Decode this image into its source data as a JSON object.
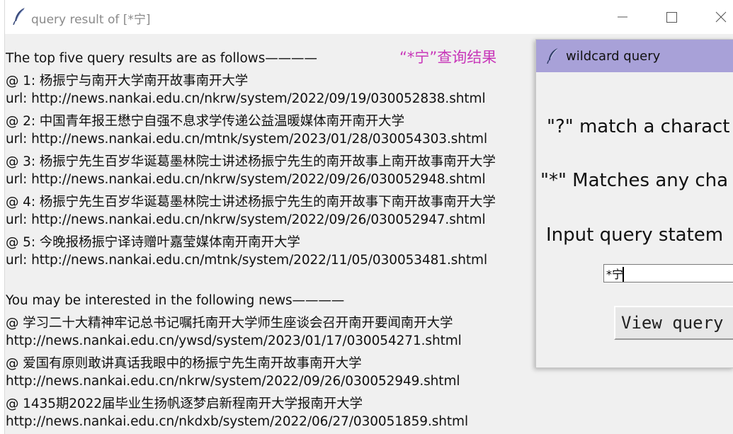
{
  "main_window": {
    "title": "query result of [*宁]",
    "feather_icon": "feather-icon",
    "controls": [
      "minimize-icon",
      "maximize-icon",
      "close-icon"
    ],
    "heading": "“*宁”查询结果",
    "heading_color": "#c837b9",
    "results_intro": "The top five query results are as follows————",
    "results": [
      {
        "title": " @ 1: 杨振宁与南开大学南开故事南开大学",
        "url": " url: http://news.nankai.edu.cn/nkrw/system/2022/09/19/030052838.shtml"
      },
      {
        "title": " @ 2: 中国青年报王懋宁自强不息求学传递公益温暖媒体南开南开大学",
        "url": " url: http://news.nankai.edu.cn/mtnk/system/2023/01/28/030054303.shtml"
      },
      {
        "title": " @ 3: 杨振宁先生百岁华诞葛墨林院士讲述杨振宁先生的南开故事上南开故事南开大学",
        "url": " url: http://news.nankai.edu.cn/nkrw/system/2022/09/26/030052948.shtml"
      },
      {
        "title": " @ 4: 杨振宁先生百岁华诞葛墨林院士讲述杨振宁先生的南开故事下南开故事南开大学",
        "url": " url: http://news.nankai.edu.cn/nkrw/system/2022/09/26/030052947.shtml"
      },
      {
        "title": " @ 5: 今晚报杨振宁译诗赠叶嘉莹媒体南开南开大学",
        "url": " url: http://news.nankai.edu.cn/mtnk/system/2022/11/05/030053481.shtml"
      }
    ],
    "interest_intro": "You may be interested in the following news————",
    "interest": [
      {
        "title": "@ 学习二十大精神牢记总书记嘱托南开大学师生座谈会召开南开要闻南开大学",
        "url": " http://news.nankai.edu.cn/ywsd/system/2023/01/17/030054271.shtml"
      },
      {
        "title": "@ 爱国有原则敢讲真话我眼中的杨振宁先生南开故事南开大学",
        "url": " http://news.nankai.edu.cn/nkrw/system/2022/09/26/030052949.shtml"
      },
      {
        "title": "@ 1435期2022届毕业生扬帆逐梦启新程南开大学报南开大学",
        "url": " http://news.nankai.edu.cn/nkdxb/system/2022/06/27/030051859.shtml"
      }
    ]
  },
  "wildcard_window": {
    "title": "wildcard query",
    "title_bar_color": "#a8a1d8",
    "help_question": "\"?\" match a charact",
    "help_star": "\"*\" Matches any cha",
    "input_label": "Input query statem",
    "input_value": "*宁",
    "button_label": "View query"
  }
}
